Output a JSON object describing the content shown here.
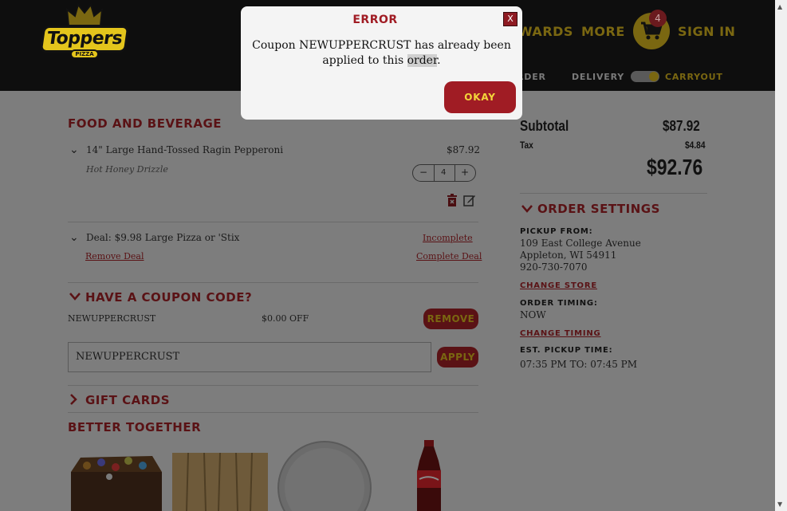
{
  "header": {
    "logo_text": "Toppers",
    "logo_sub": "PIZZA",
    "nav_rewards": "WARDS",
    "nav_more": "MORE",
    "cart_count": "4",
    "nav_signin": "SIGN IN",
    "subnav_order": "RDER",
    "subnav_delivery": "DELIVERY",
    "subnav_carryout": "CARRYOUT"
  },
  "cart": {
    "section_title": "FOOD AND BEVERAGE",
    "item1": {
      "name": "14\" Large Hand-Tossed Ragin Pepperoni",
      "price": "$87.92",
      "modifier": "Hot Honey Drizzle",
      "qty": "4",
      "minus": "−",
      "plus": "+"
    },
    "deal": {
      "name": "Deal: $9.98 Large Pizza or 'Stix",
      "status": "Incomplete",
      "remove": "Remove Deal",
      "complete": "Complete Deal"
    }
  },
  "coupon": {
    "title": "HAVE A COUPON CODE?",
    "code": "NEWUPPERCRUST",
    "discount": "$0.00 OFF",
    "remove_label": "REMOVE",
    "input_value": "NEWUPPERCRUST",
    "apply_label": "APPLY"
  },
  "gift_cards": {
    "title": "GIFT CARDS"
  },
  "better_together": {
    "title": "BETTER TOGETHER"
  },
  "summary": {
    "subtotal_label": "Subtotal",
    "subtotal": "$87.92",
    "tax_label": "Tax",
    "tax": "$4.84",
    "total": "$92.76"
  },
  "order_settings": {
    "title": "ORDER SETTINGS",
    "pickup_from_label": "PICKUP FROM:",
    "address1": "109 East College Avenue",
    "address2": "Appleton, WI 54911",
    "phone": "920-730-7070",
    "change_store": "CHANGE STORE",
    "order_timing_label": "ORDER TIMING:",
    "order_timing": "NOW",
    "change_timing": "CHANGE TIMING",
    "pickup_time_label": "EST. PICKUP TIME:",
    "pickup_time": "07:35 PM TO: 07:45 PM"
  },
  "modal": {
    "title": "ERROR",
    "close": "X",
    "message_part1": "Coupon NEWUPPERCRUST has already been applied to this ",
    "message_highlight": "order",
    "message_end": ".",
    "ok_label": "OKAY"
  },
  "colors": {
    "brand_red": "#a01c24",
    "brand_yellow": "#f3d53a",
    "overlay_gray": "#7d7d7d"
  }
}
